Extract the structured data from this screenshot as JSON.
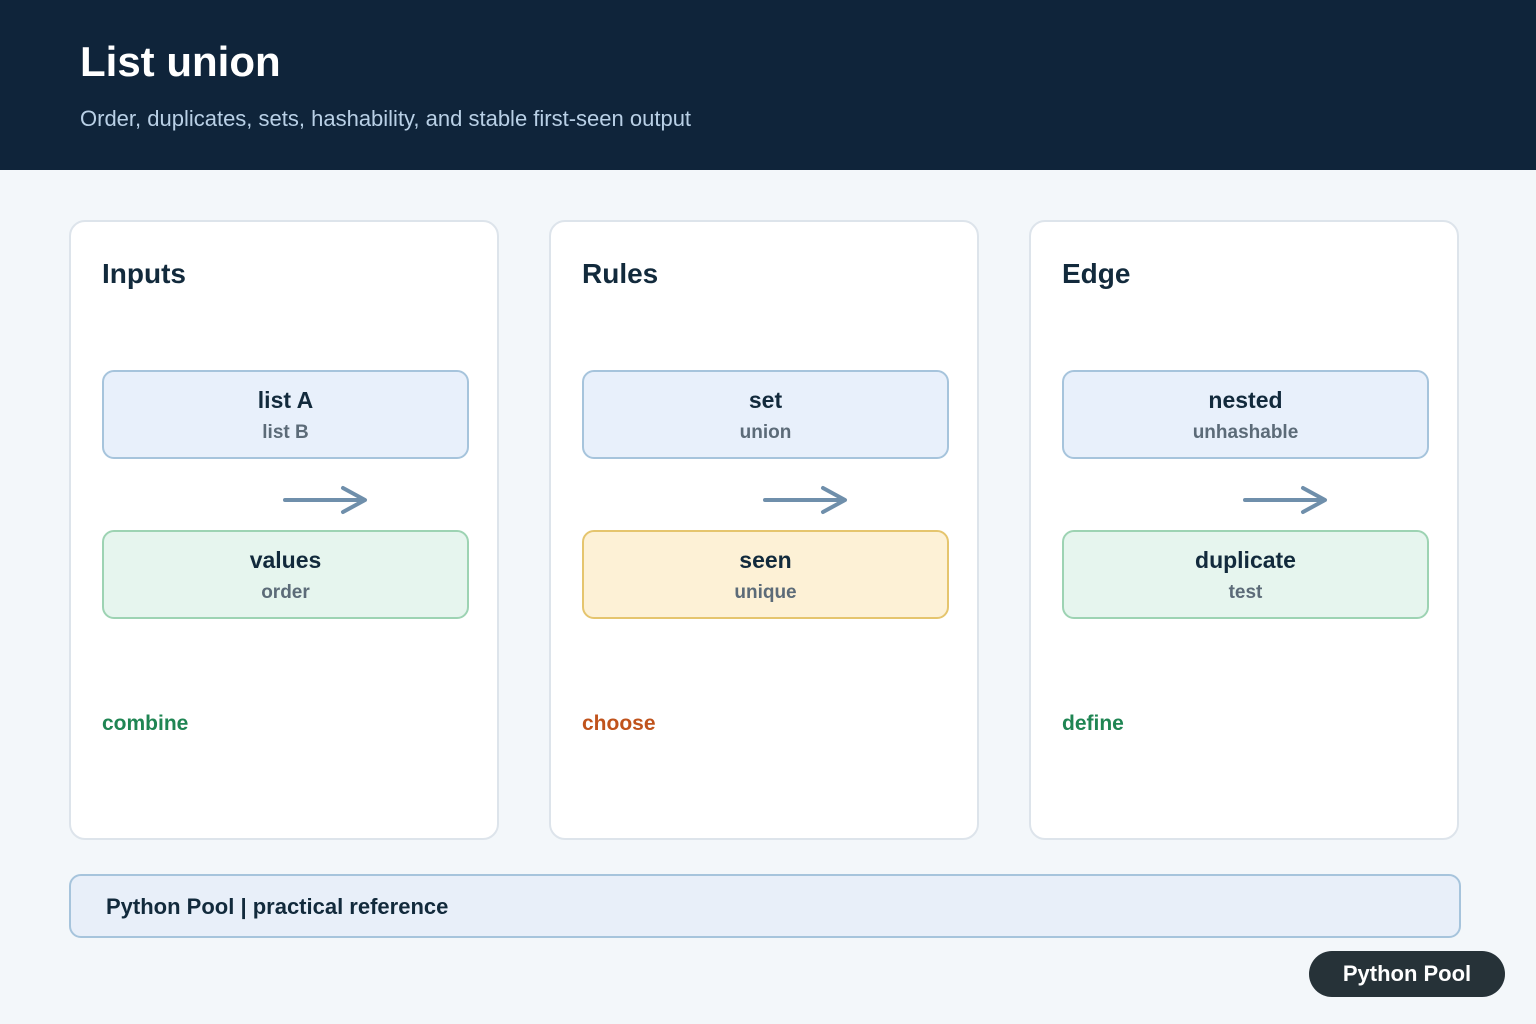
{
  "header": {
    "title": "List union",
    "subtitle": "Order, duplicates, sets, hashability, and stable first-seen output"
  },
  "colors": {
    "header_bg": "#0f243a",
    "arrow": "#6f8fab",
    "green_text": "#1f8553",
    "orange_text": "#c0531c"
  },
  "cards": [
    {
      "title": "Inputs",
      "top": {
        "title": "list A",
        "sub": "list B",
        "fill": "#e8f0fb",
        "stroke": "#a6c4dc"
      },
      "bottom": {
        "title": "values",
        "sub": "order",
        "fill": "#e6f5ee",
        "stroke": "#9dd3b3"
      },
      "action": "combine",
      "action_color": "#1f8553"
    },
    {
      "title": "Rules",
      "top": {
        "title": "set",
        "sub": "union",
        "fill": "#e8f0fb",
        "stroke": "#a6c4dc"
      },
      "bottom": {
        "title": "seen",
        "sub": "unique",
        "fill": "#fdf1d6",
        "stroke": "#e5c56e"
      },
      "action": "choose",
      "action_color": "#c0531c"
    },
    {
      "title": "Edge",
      "top": {
        "title": "nested",
        "sub": "unhashable",
        "fill": "#e8f0fb",
        "stroke": "#a6c4dc"
      },
      "bottom": {
        "title": "duplicate",
        "sub": "test",
        "fill": "#e6f5ee",
        "stroke": "#9dd3b3"
      },
      "action": "define",
      "action_color": "#1f8553"
    }
  ],
  "footer": {
    "text": "Python Pool | practical reference"
  },
  "badge": {
    "label": "Python Pool"
  }
}
